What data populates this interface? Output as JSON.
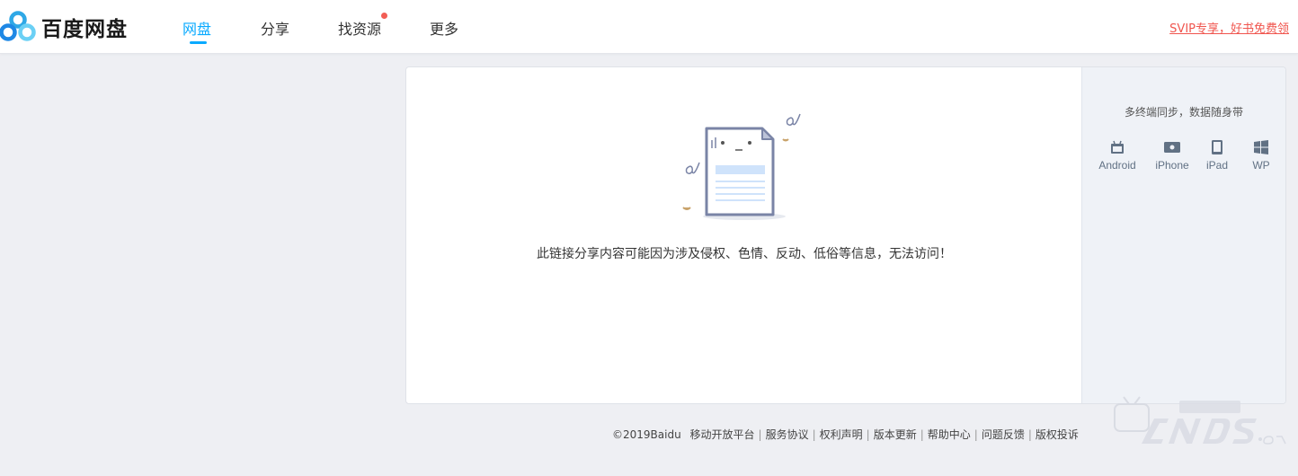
{
  "header": {
    "logo_text": "百度网盘",
    "nav": [
      {
        "label": "网盘",
        "active": true
      },
      {
        "label": "分享",
        "active": false
      },
      {
        "label": "找资源",
        "active": false,
        "badge_dot": true
      },
      {
        "label": "更多",
        "active": false
      }
    ],
    "promo_link": "SVIP专享，好书免费领"
  },
  "main": {
    "message": "此链接分享内容可能因为涉及侵权、色情、反动、低俗等信息，无法访问！"
  },
  "sidebar": {
    "title": "多终端同步，数据随身带",
    "platforms": [
      {
        "label": "Android",
        "icon": "android-icon"
      },
      {
        "label": "iPhone",
        "icon": "iphone-icon"
      },
      {
        "label": "iPad",
        "icon": "ipad-icon"
      },
      {
        "label": "WP",
        "icon": "windows-phone-icon"
      }
    ]
  },
  "footer": {
    "copyright": "©2019Baidu",
    "links": [
      "移动开放平台",
      "服务协议",
      "权利声明",
      "版本更新",
      "帮助中心",
      "问题反馈",
      "版权投诉"
    ]
  },
  "colors": {
    "accent": "#09aaff",
    "promo": "#f0554e",
    "background": "#eeeff3"
  }
}
